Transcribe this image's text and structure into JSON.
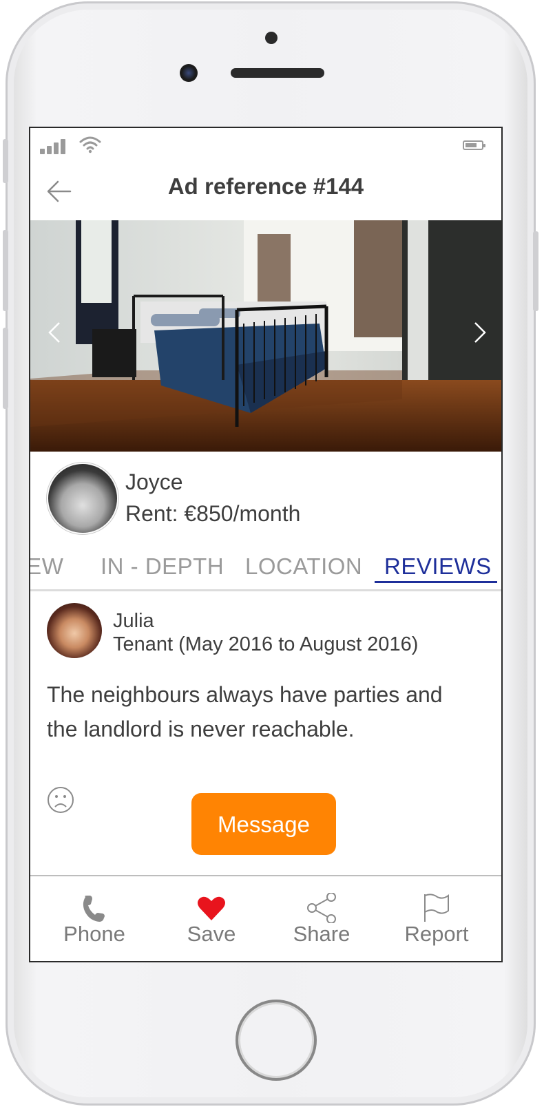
{
  "status_bar": {
    "signal_icon": "signal-bars-icon",
    "wifi_icon": "wifi-icon",
    "battery_icon": "battery-icon"
  },
  "header": {
    "title": "Ad reference #144",
    "back_icon": "arrow-left-icon"
  },
  "gallery": {
    "prev_icon": "chevron-left-icon",
    "next_icon": "chevron-right-icon"
  },
  "owner": {
    "name": "Joyce",
    "rent": "Rent: €850/month"
  },
  "tabs": [
    {
      "label": "VIEW"
    },
    {
      "label": "IN - DEPTH"
    },
    {
      "label": "LOCATION"
    },
    {
      "label": "REVIEWS",
      "active": true
    }
  ],
  "review": {
    "name": "Julia",
    "role": "Tenant (May 2016 to August 2016)",
    "text": "The neighbours always have parties and the landlord is never reachable.",
    "mood_icon": "sad-face-icon"
  },
  "actions": {
    "message_label": "Message"
  },
  "bottom_nav": [
    {
      "label": "Phone",
      "icon": "phone-icon"
    },
    {
      "label": "Save",
      "icon": "heart-icon"
    },
    {
      "label": "Share",
      "icon": "share-icon"
    },
    {
      "label": "Report",
      "icon": "flag-icon"
    }
  ],
  "colors": {
    "accent": "#ff8403",
    "active_tab": "#1e2f9a",
    "heart": "#e8141d"
  }
}
